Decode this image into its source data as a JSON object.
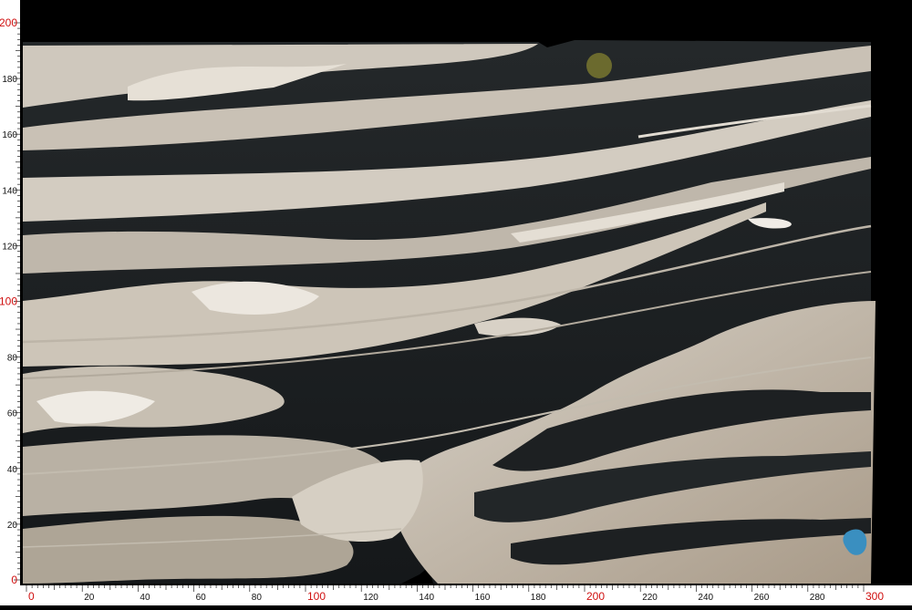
{
  "image": {
    "subject": "marble-slab",
    "colors": {
      "background": "#000000",
      "ruler": "#ffffff",
      "major_label": "#d01010",
      "minor_label": "#111111",
      "vein_dark": "#1d2022",
      "vein_light": "#cfc8bd",
      "vein_warm": "#a89a88"
    }
  },
  "ruler": {
    "x_axis": {
      "labels": [
        "0",
        "20",
        "40",
        "60",
        "80",
        "100",
        "120",
        "140",
        "160",
        "180",
        "200",
        "220",
        "240",
        "260",
        "280",
        "300"
      ],
      "major": [
        "0",
        "100",
        "200",
        "300"
      ]
    },
    "y_axis": {
      "labels": [
        "0",
        "20",
        "40",
        "60",
        "80",
        "100",
        "120",
        "140",
        "160",
        "180",
        "200"
      ],
      "major": [
        "0",
        "100",
        "200"
      ]
    }
  }
}
